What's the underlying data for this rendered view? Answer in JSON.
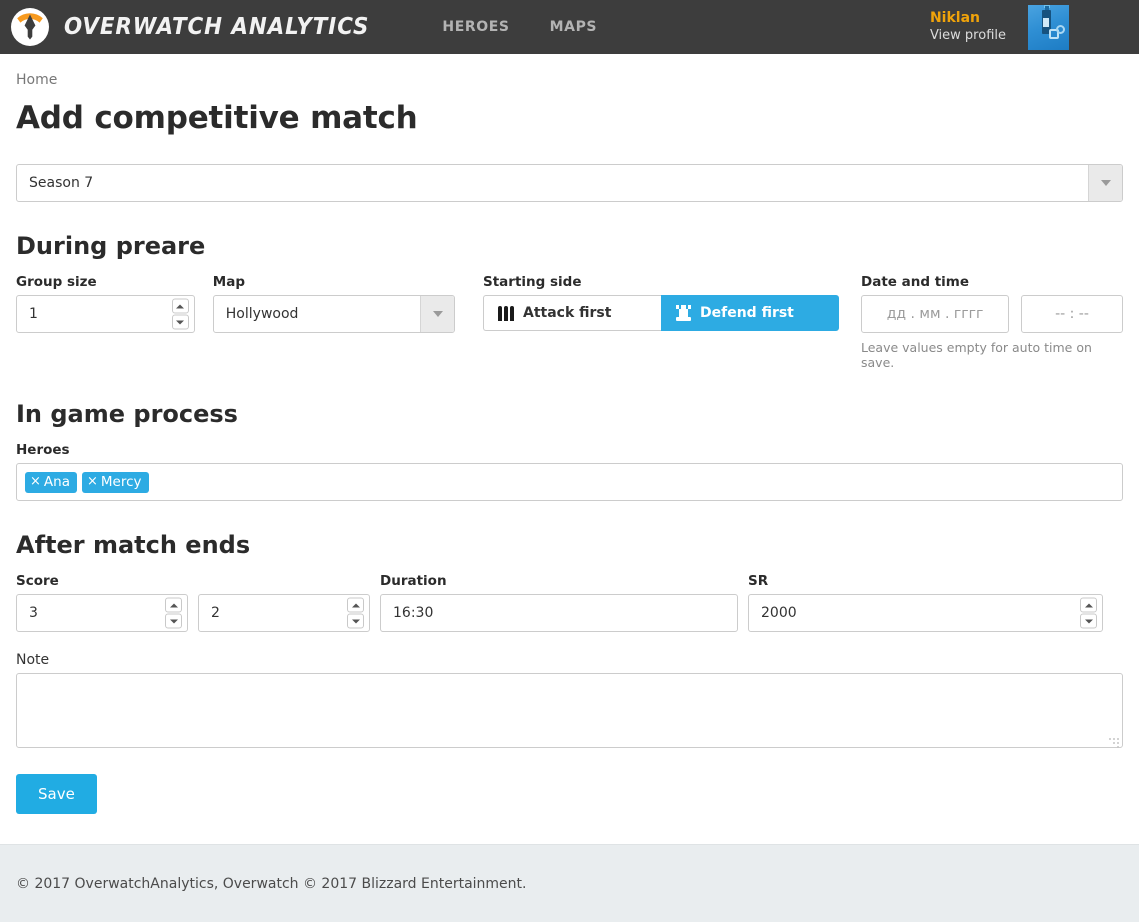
{
  "navbar": {
    "brand": "OVERWATCH ANALYTICS",
    "logo_icon": "overwatch-logo-icon",
    "links": [
      {
        "label": "HEROES",
        "name": "nav-link-heroes"
      },
      {
        "label": "MAPS",
        "name": "nav-link-maps"
      }
    ],
    "user": {
      "name": "Niklan",
      "sub": "View profile",
      "avatar_icon": "user-avatar-bottle-image"
    }
  },
  "breadcrumb": "Home",
  "page_title": "Add competitive match",
  "season": {
    "label": "",
    "value": "Season 7",
    "caret_icon": "chevron-down-icon"
  },
  "sections": {
    "prepare": {
      "title": "During preare",
      "group_size": {
        "label": "Group size",
        "value": "1"
      },
      "map": {
        "label": "Map",
        "value": "Hollywood",
        "caret_icon": "chevron-down-icon"
      },
      "starting_side": {
        "label": "Starting side",
        "options": [
          {
            "label": "Attack first",
            "icon": "bullets-icon",
            "active": false
          },
          {
            "label": "Defend first",
            "icon": "rook-icon",
            "active": true
          }
        ]
      },
      "datetime": {
        "label": "Date and time",
        "date_placeholder": "дд . мм . гггг",
        "date_value": "",
        "time_placeholder": "-- : --",
        "time_value": "",
        "hint": "Leave values empty for auto time on save."
      }
    },
    "ingame": {
      "title": "In game process",
      "heroes": {
        "label": "Heroes",
        "tags": [
          {
            "label": "Ana",
            "remove_icon": "close-icon"
          },
          {
            "label": "Mercy",
            "remove_icon": "close-icon"
          }
        ]
      }
    },
    "after": {
      "title": "After match ends",
      "score": {
        "label": "Score",
        "value_self": "3",
        "value_enemy": "2"
      },
      "duration": {
        "label": "Duration",
        "value": "16:30"
      },
      "sr": {
        "label": "SR",
        "value": "2000"
      },
      "note": {
        "label": "Note",
        "value": "",
        "placeholder": ""
      }
    }
  },
  "save_button": "Save",
  "footer": "© 2017 OverwatchAnalytics, Overwatch © 2017 Blizzard Entertainment.",
  "colors": {
    "navbar_bg": "#3d3d3d",
    "accent_blue": "#2dabe3",
    "save_blue": "#21ace3",
    "user_name_orange": "#f0a30a",
    "logo_orange": "#f79a1f",
    "footer_bg": "#e9edef"
  }
}
